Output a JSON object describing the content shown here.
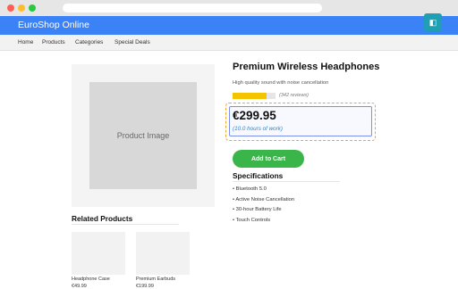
{
  "app": {
    "title": "EuroShop Online",
    "header_color": "#3b82f6"
  },
  "nav": {
    "items": [
      "Home",
      "Products",
      "Categories",
      "Special Deals"
    ]
  },
  "product": {
    "image_placeholder": "Product Image",
    "title": "Premium Wireless Headphones",
    "subtitle": "High quality sound with noise cancellation",
    "rating_fraction": 0.8,
    "review_count": "(342 reviews)",
    "price": "€299.95",
    "work_hours": "(10.0 hours of work)",
    "add_to_cart": "Add to Cart"
  },
  "specs": {
    "heading": "Specifications",
    "items": [
      "• Bluetooth 5.0",
      "• Active Noise Cancellation",
      "• 30-hour Battery Life",
      "• Touch Controls"
    ]
  },
  "related": {
    "heading": "Related Products",
    "items": [
      {
        "name": "Headphone Case",
        "price": "€49.99"
      },
      {
        "name": "Premium Earbuds",
        "price": "€199.99"
      }
    ]
  },
  "icons": {
    "extension": "extension-icon"
  },
  "colors": {
    "accent": "#3b82f6",
    "cart_button": "#3ab54a",
    "highlight": "#f5a524",
    "rating": "#f5c400",
    "work_hours_text": "#2a87d0"
  }
}
